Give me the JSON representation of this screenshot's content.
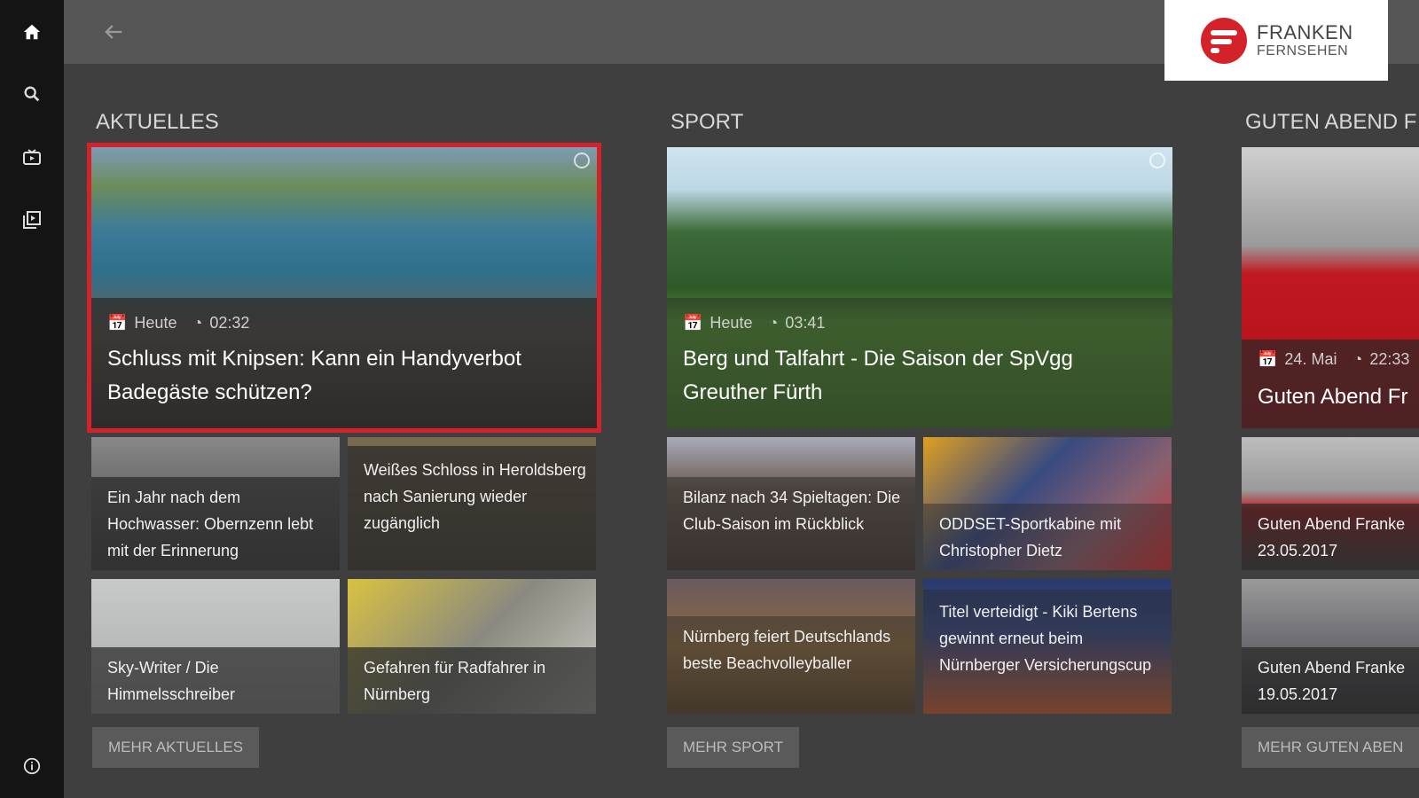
{
  "nav": {
    "items": [
      {
        "icon": "home-icon"
      },
      {
        "icon": "search-icon"
      },
      {
        "icon": "tv-icon"
      },
      {
        "icon": "library-icon"
      }
    ],
    "info_icon": "info-icon"
  },
  "header": {
    "back_icon": "arrow-left-icon",
    "logo_line1": "FRANKEN",
    "logo_line2": "FERNSEHEN",
    "brand_color": "#d4222a"
  },
  "sections": [
    {
      "title": "AKTUELLES",
      "featured": {
        "date": "Heute",
        "duration": "02:32",
        "title": "Schluss mit Knipsen: Kann ein Handyverbot Badegäste schützen?"
      },
      "items": [
        {
          "title": "Ein Jahr nach dem Hochwasser: Obernzenn lebt mit der Erinnerung"
        },
        {
          "title": "Weißes Schloss in Heroldsberg nach Sanierung wieder zugänglich"
        },
        {
          "title": "Sky-Writer / Die Himmelsschreiber"
        },
        {
          "title": "Gefahren für Radfahrer in Nürnberg"
        }
      ],
      "more": "MEHR AKTUELLES"
    },
    {
      "title": "SPORT",
      "featured": {
        "date": "Heute",
        "duration": "03:41",
        "title": "Berg und Talfahrt - Die Saison der SpVgg Greuther Fürth"
      },
      "items": [
        {
          "title": "Bilanz nach 34 Spieltagen: Die Club-Saison im Rückblick"
        },
        {
          "title": "ODDSET-Sportkabine mit Christopher Dietz"
        },
        {
          "title": "Nürnberg feiert Deutschlands beste Beachvolleyballer"
        },
        {
          "title": "Titel verteidigt - Kiki Bertens gewinnt erneut beim Nürnberger Versicherungscup"
        }
      ],
      "more": "MEHR SPORT"
    },
    {
      "title": "GUTEN ABEND F",
      "featured": {
        "date": "24. Mai",
        "duration": "22:33",
        "title": "Guten Abend Fr"
      },
      "items": [
        {
          "title": "Guten Abend Franke 23.05.2017"
        },
        {
          "title": "Guten Abend Franke 19.05.2017"
        }
      ],
      "more": "MEHR GUTEN ABEN"
    }
  ]
}
